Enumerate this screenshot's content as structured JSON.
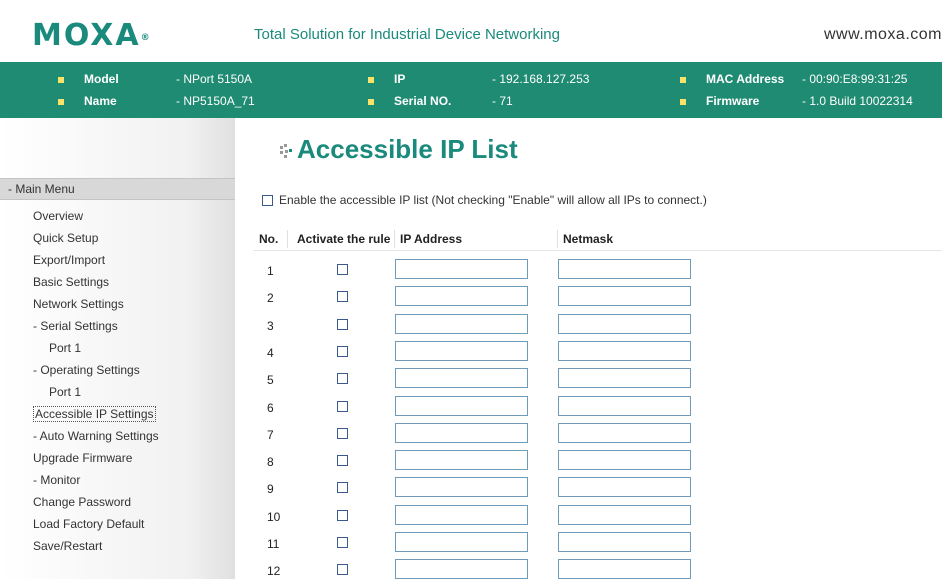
{
  "header": {
    "logo": "MOXA",
    "logo_mark": "®",
    "tagline": "Total Solution for Industrial Device Networking",
    "website": "www.moxa.com"
  },
  "device_info": {
    "model_label": "Model",
    "model_value": "- NPort 5150A",
    "name_label": "Name",
    "name_value": "- NP5150A_71",
    "ip_label": "IP",
    "ip_value": "- 192.168.127.253",
    "serial_label": "Serial NO.",
    "serial_value": "- 71",
    "mac_label": "MAC Address",
    "mac_value": "- 00:90:E8:99:31:25",
    "firmware_label": "Firmware",
    "firmware_value": "- 1.0 Build 10022314"
  },
  "page_title": "Accessible IP List",
  "menu": {
    "header": "- Main Menu",
    "items": [
      "Overview",
      "Quick Setup",
      "Export/Import",
      "Basic Settings",
      "Network Settings",
      "- Serial Settings",
      "Port 1",
      "- Operating Settings",
      "Port 1",
      "Accessible IP Settings",
      "- Auto Warning Settings",
      "Upgrade Firmware",
      "- Monitor",
      "Change Password",
      "Load Factory Default",
      "Save/Restart"
    ]
  },
  "enable_label": "Enable the accessible IP list (Not checking \"Enable\" will allow all IPs to connect.)",
  "table": {
    "col_no": "No.",
    "col_activate": "Activate the rule",
    "col_ip": "IP Address",
    "col_netmask": "Netmask",
    "rows": [
      "1",
      "2",
      "3",
      "4",
      "5",
      "6",
      "7",
      "8",
      "9",
      "10",
      "11",
      "12"
    ]
  },
  "colors": {
    "brand_green": "#1f8b73",
    "bullet_yellow": "#f7e36a"
  }
}
